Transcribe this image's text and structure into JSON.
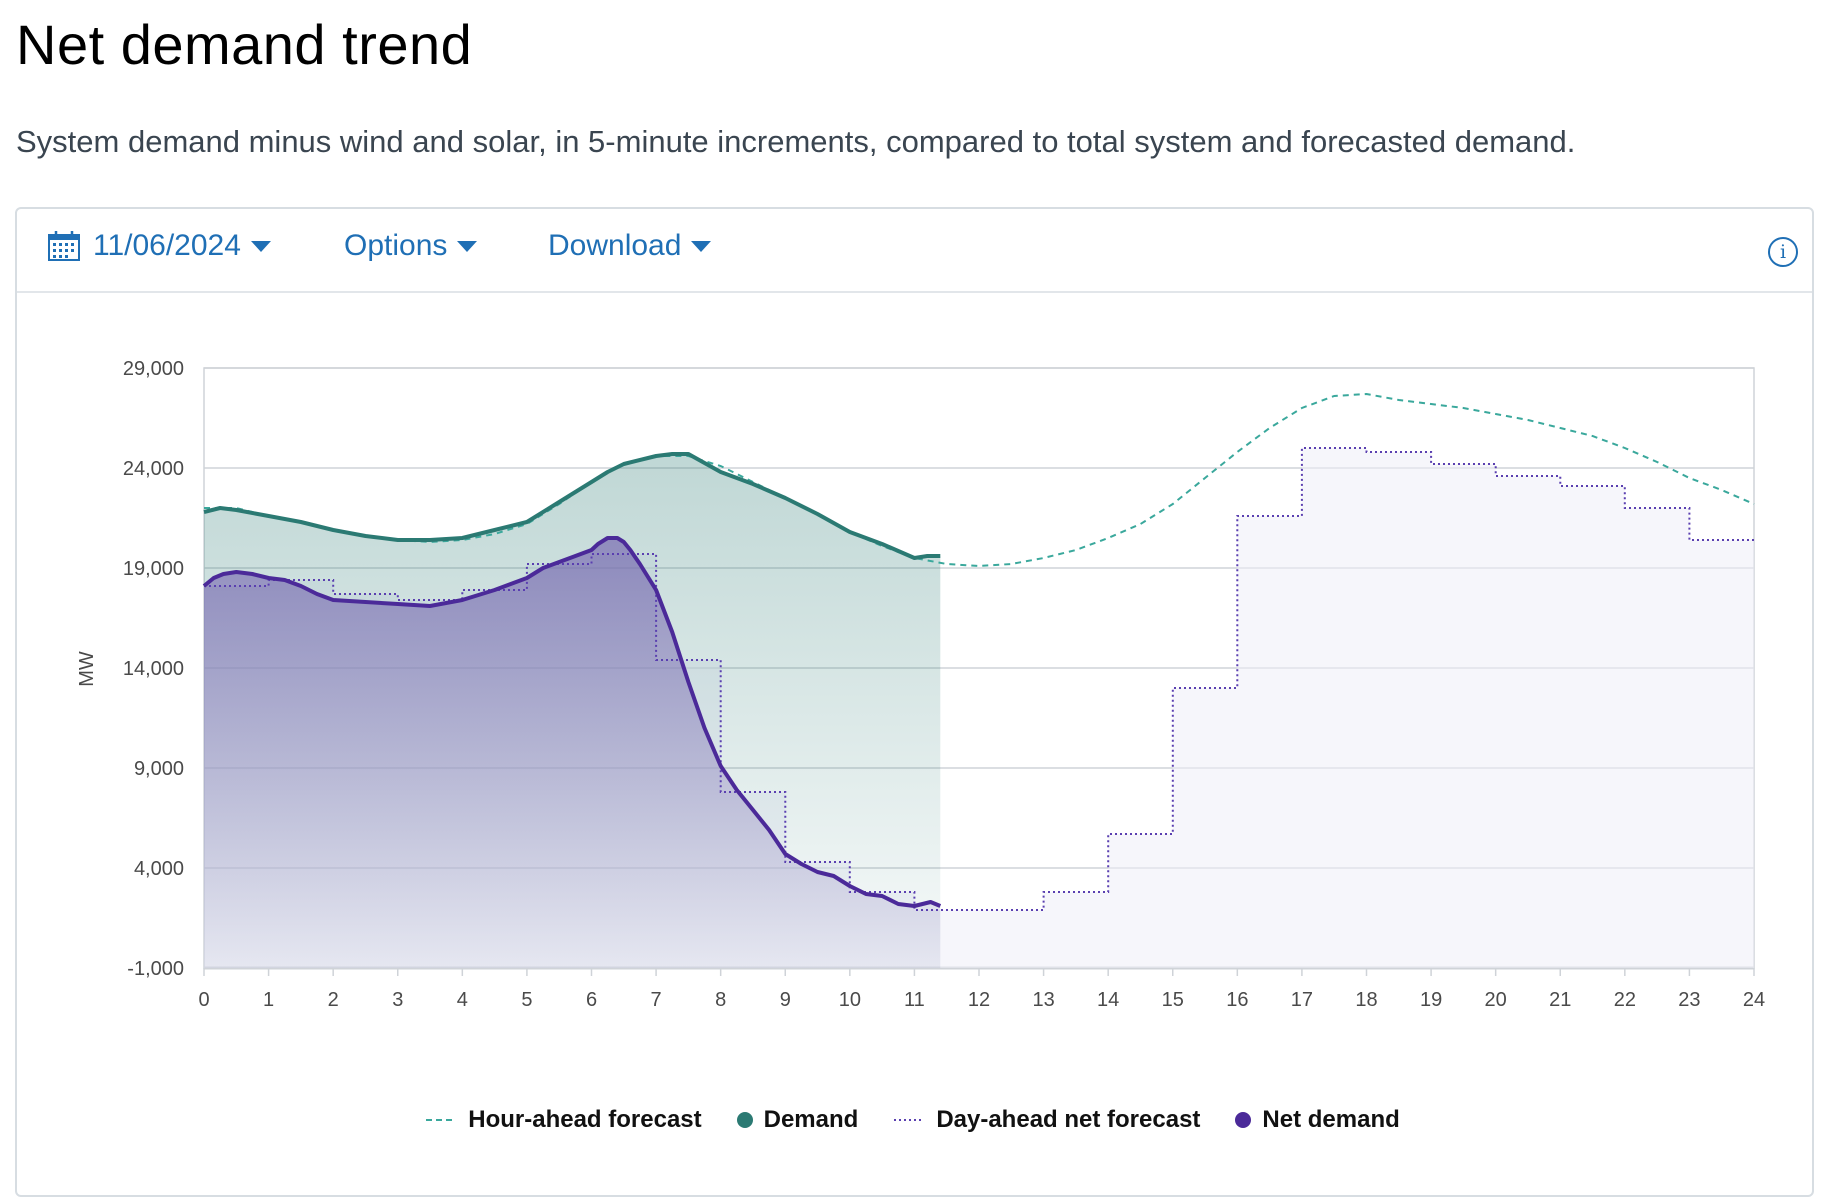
{
  "page": {
    "title": "Net demand trend",
    "subtitle": "System demand minus wind and solar, in 5-minute increments, compared to total system and forecasted demand."
  },
  "toolbar": {
    "date": "11/06/2024",
    "options_label": "Options",
    "download_label": "Download",
    "calendar_icon": "calendar-icon",
    "info_icon": "info-icon",
    "info_glyph": "i"
  },
  "colors": {
    "demand": "#2b7a73",
    "hour_ahead": "#3aa89c",
    "net_demand": "#4b2a99",
    "day_ahead": "#5a3fb0",
    "link": "#1f6fb5",
    "grid": "#cfd3d8"
  },
  "chart_data": {
    "type": "line",
    "title": "",
    "xlabel": "",
    "ylabel": "MW",
    "xlim": [
      0,
      24
    ],
    "ylim": [
      -1000,
      29000
    ],
    "xticks": [
      0,
      1,
      2,
      3,
      4,
      5,
      6,
      7,
      8,
      9,
      10,
      11,
      12,
      13,
      14,
      15,
      16,
      17,
      18,
      19,
      20,
      21,
      22,
      23,
      24
    ],
    "yticks": [
      -1000,
      4000,
      9000,
      14000,
      19000,
      24000,
      29000
    ],
    "ytick_labels": [
      "-1,000",
      "4,000",
      "9,000",
      "14,000",
      "19,000",
      "24,000",
      "29,000"
    ],
    "grid": true,
    "legend_position": "bottom-center",
    "series": [
      {
        "name": "Hour-ahead forecast",
        "style": "dashed",
        "x": [
          0,
          0.5,
          1,
          1.5,
          2,
          2.5,
          3,
          3.5,
          4,
          4.5,
          5,
          5.5,
          6,
          6.5,
          7,
          7.5,
          8,
          8.5,
          9,
          9.5,
          10,
          10.5,
          11,
          11.5,
          12,
          12.5,
          13,
          13.5,
          14,
          14.5,
          15,
          15.5,
          16,
          16.5,
          17,
          17.5,
          18,
          18.5,
          19,
          19.5,
          20,
          20.5,
          21,
          21.5,
          22,
          22.5,
          23,
          23.5,
          24
        ],
        "y": [
          22000,
          22000,
          21600,
          21300,
          20900,
          20600,
          20400,
          20300,
          20400,
          20700,
          21200,
          22200,
          23300,
          24200,
          24600,
          24600,
          24100,
          23300,
          22500,
          21700,
          20800,
          20100,
          19500,
          19200,
          19100,
          19200,
          19500,
          19900,
          20500,
          21200,
          22200,
          23500,
          24800,
          26000,
          27000,
          27600,
          27700,
          27400,
          27200,
          27000,
          26700,
          26400,
          26000,
          25600,
          25000,
          24300,
          23500,
          22900,
          22200
        ]
      },
      {
        "name": "Demand",
        "style": "solid",
        "x": [
          0,
          0.25,
          0.5,
          1,
          1.5,
          2,
          2.5,
          3,
          3.5,
          4,
          4.5,
          5,
          5.5,
          6,
          6.25,
          6.5,
          7,
          7.25,
          7.5,
          8,
          8.5,
          9,
          9.5,
          10,
          10.5,
          11,
          11.2,
          11.4
        ],
        "y": [
          21800,
          22000,
          21900,
          21600,
          21300,
          20900,
          20600,
          20400,
          20400,
          20500,
          20900,
          21300,
          22300,
          23300,
          23800,
          24200,
          24600,
          24700,
          24700,
          23800,
          23200,
          22500,
          21700,
          20800,
          20200,
          19500,
          19600,
          19600
        ]
      },
      {
        "name": "Day-ahead net forecast",
        "style": "dotted-step",
        "x": [
          0,
          1,
          2,
          3,
          4,
          5,
          6,
          7,
          8,
          9,
          10,
          11,
          12,
          13,
          14,
          15,
          16,
          17,
          18,
          19,
          20,
          21,
          22,
          23,
          24
        ],
        "y": [
          18100,
          18400,
          17700,
          17400,
          17900,
          19200,
          19700,
          14400,
          7800,
          4300,
          2800,
          1900,
          1900,
          2800,
          5700,
          13000,
          21600,
          25000,
          24800,
          24200,
          23600,
          23100,
          22000,
          20400,
          20400
        ]
      },
      {
        "name": "Net demand",
        "style": "solid",
        "x": [
          0,
          0.15,
          0.3,
          0.5,
          0.75,
          1,
          1.25,
          1.5,
          1.75,
          2,
          2.5,
          3,
          3.5,
          4,
          4.5,
          5,
          5.25,
          5.5,
          5.75,
          6,
          6.1,
          6.25,
          6.4,
          6.5,
          6.6,
          6.75,
          7,
          7.25,
          7.5,
          7.75,
          8,
          8.25,
          8.5,
          8.75,
          9,
          9.25,
          9.5,
          9.75,
          10,
          10.25,
          10.5,
          10.75,
          11,
          11.25,
          11.4
        ],
        "y": [
          18100,
          18500,
          18700,
          18800,
          18700,
          18500,
          18400,
          18100,
          17700,
          17400,
          17300,
          17200,
          17100,
          17400,
          17900,
          18500,
          19000,
          19300,
          19600,
          19900,
          20200,
          20500,
          20500,
          20300,
          19900,
          19200,
          17900,
          15800,
          13300,
          11000,
          9100,
          7900,
          6900,
          5900,
          4700,
          4200,
          3800,
          3600,
          3100,
          2700,
          2600,
          2200,
          2100,
          2300,
          2100
        ]
      }
    ]
  },
  "legend": {
    "items": [
      {
        "label": "Hour-ahead forecast",
        "marker": "dashed-line"
      },
      {
        "label": "Demand",
        "marker": "dot"
      },
      {
        "label": "Day-ahead net forecast",
        "marker": "dotted-line"
      },
      {
        "label": "Net demand",
        "marker": "dot"
      }
    ]
  }
}
